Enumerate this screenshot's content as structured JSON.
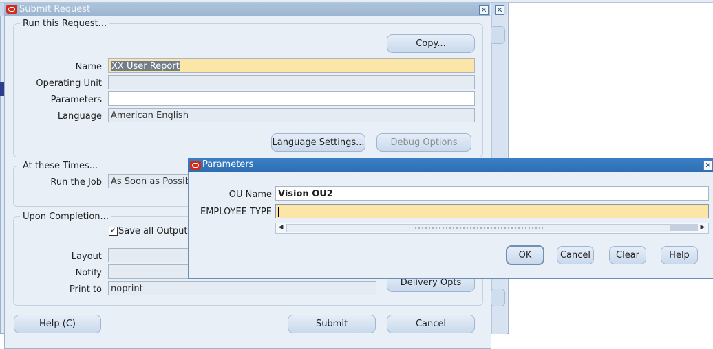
{
  "submit_dialog": {
    "title": "Submit Request",
    "run_group": {
      "legend": "Run this Request...",
      "copy_button": "Copy...",
      "name_label": "Name",
      "name_value": "XX User Report",
      "operating_unit_label": "Operating Unit",
      "operating_unit_value": "",
      "parameters_label": "Parameters",
      "parameters_value": "",
      "language_label": "Language",
      "language_value": "American English",
      "language_settings_button": "Language Settings...",
      "debug_options_button": "Debug Options"
    },
    "times_group": {
      "legend": "At these Times...",
      "run_job_label": "Run the Job",
      "run_job_value": "As Soon as Possib"
    },
    "completion_group": {
      "legend": "Upon Completion...",
      "save_output_label": "Save all Output F",
      "save_output_checked": true,
      "layout_label": "Layout",
      "notify_label": "Notify",
      "print_to_label": "Print to",
      "print_to_value": "noprint",
      "delivery_opts_button": "Delivery Opts"
    },
    "help_button": "Help (C)",
    "submit_button": "Submit",
    "cancel_button": "Cancel"
  },
  "parameters_dialog": {
    "title": "Parameters",
    "ou_name_label": "OU Name",
    "ou_name_value": "Vision OU2",
    "employee_type_label": "EMPLOYEE TYPE",
    "employee_type_value": "",
    "ok_button": "OK",
    "cancel_button": "Cancel",
    "clear_button": "Clear",
    "help_button": "Help"
  },
  "icons": {
    "oracle": "oracle-logo-icon",
    "close": "close-icon",
    "checkbox": "checkbox-icon",
    "scroll_left": "scroll-left-arrow-icon",
    "scroll_right": "scroll-right-arrow-icon"
  },
  "colors": {
    "title_inactive": "#9bb4d0",
    "title_active": "#2e6fb3",
    "field_required": "#fbe6a8",
    "dialog_bg": "#e8eff7"
  }
}
